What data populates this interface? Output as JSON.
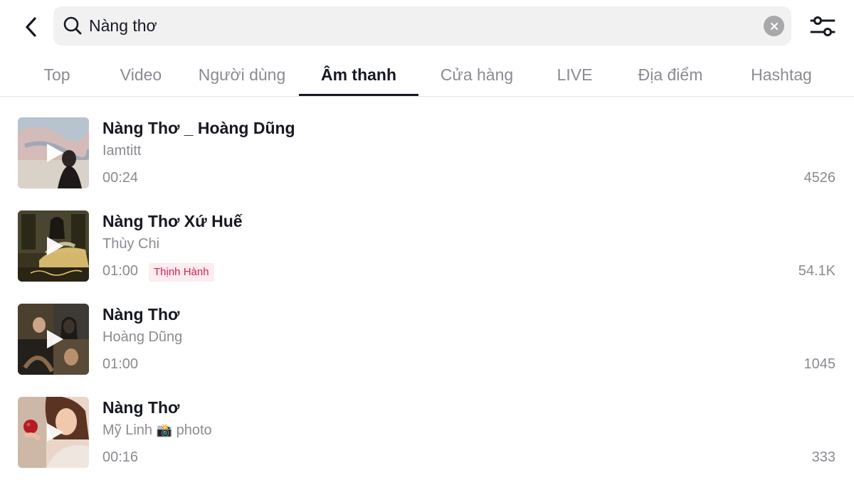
{
  "header": {
    "search_value": "Nàng thơ",
    "back_icon": "chevron-left-icon",
    "clear_icon": "clear-x-icon",
    "filter_icon": "sliders-icon"
  },
  "tabs": [
    {
      "label": "Top"
    },
    {
      "label": "Video"
    },
    {
      "label": "Người dùng"
    },
    {
      "label": "Âm thanh",
      "active": true
    },
    {
      "label": "Cửa hàng"
    },
    {
      "label": "LIVE"
    },
    {
      "label": "Địa điểm"
    },
    {
      "label": "Hashtag"
    }
  ],
  "sounds": [
    {
      "title": "Nàng Thơ _ Hoàng Dũng",
      "artist": "Iamtitt",
      "duration": "00:24",
      "count": "4526"
    },
    {
      "title": "Nàng Thơ Xứ Huế",
      "artist": "Thùy Chi",
      "duration": "01:00",
      "badge": "Thịnh Hành",
      "count": "54.1K"
    },
    {
      "title": "Nàng Thơ",
      "artist": "Hoàng Dũng",
      "duration": "01:00",
      "count": "1045"
    },
    {
      "title": "Nàng Thơ",
      "artist": "Mỹ Linh",
      "artist_emoji": "📸",
      "artist_suffix": "photo",
      "duration": "00:16",
      "count": "333"
    }
  ],
  "colors": {
    "active_text": "#161823",
    "muted_text": "#8a8b91",
    "badge_text": "#d4244a",
    "badge_bg": "#fdecf0"
  }
}
